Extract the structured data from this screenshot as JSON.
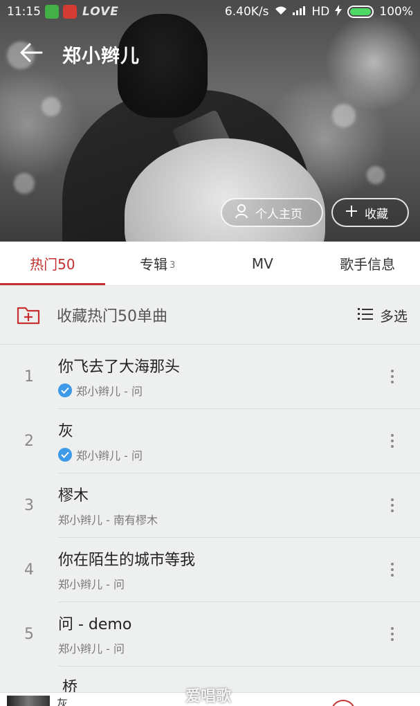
{
  "status_bar": {
    "time": "11:15",
    "network_speed": "6.40K/s",
    "network_type": "HD",
    "battery": "100%",
    "battery_level": 1.0,
    "wallpaper_text": "LOVE"
  },
  "header": {
    "title": "郑小辫儿",
    "back_icon": "arrow-left-icon"
  },
  "actions": {
    "profile_label": "个人主页",
    "profile_icon": "person-icon",
    "collect_label": "收藏",
    "collect_icon": "plus-icon"
  },
  "tabs": [
    {
      "label": "热门50",
      "count": "",
      "active": true
    },
    {
      "label": "专辑",
      "count": "3",
      "active": false
    },
    {
      "label": "MV",
      "count": "",
      "active": false
    },
    {
      "label": "歌手信息",
      "count": "",
      "active": false
    }
  ],
  "collect_row": {
    "label": "收藏热门50单曲",
    "icon": "folder-add-icon",
    "multi_select_label": "多选",
    "multi_select_icon": "list-icon"
  },
  "songs": [
    {
      "index": "1",
      "title": "你飞去了大海那头",
      "subtitle": "郑小辫儿 - 问",
      "verified": true
    },
    {
      "index": "2",
      "title": "灰",
      "subtitle": "郑小辫儿 - 问",
      "verified": true
    },
    {
      "index": "3",
      "title": "樛木",
      "subtitle": "郑小辫儿 - 南有樛木",
      "verified": false
    },
    {
      "index": "4",
      "title": "你在陌生的城市等我",
      "subtitle": "郑小辫儿 - 问",
      "verified": false
    },
    {
      "index": "5",
      "title": "问 - demo",
      "subtitle": "郑小辫儿 - 问",
      "verified": false
    }
  ],
  "partial_song": {
    "title": "桥"
  },
  "player": {
    "text": "灰"
  },
  "watermark": "爱唱歌",
  "colors": {
    "accent": "#c62f2f",
    "verified": "#3d9ae8",
    "background": "#eef0ef"
  }
}
